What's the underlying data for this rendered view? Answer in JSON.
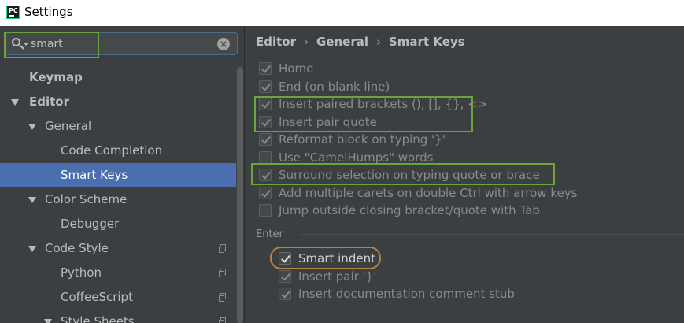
{
  "window": {
    "title": "Settings",
    "icon": "pycharm-app-icon",
    "icon_text": "PC"
  },
  "search": {
    "value": "smart",
    "clear_icon": "clear-icon"
  },
  "tree": [
    {
      "label": "Keymap",
      "level": 0,
      "bold": true,
      "expanded": null,
      "selected": false,
      "has_copy_icon": false
    },
    {
      "label": "Editor",
      "level": 0,
      "bold": true,
      "expanded": true,
      "selected": false,
      "has_copy_icon": false
    },
    {
      "label": "General",
      "level": 1,
      "bold": false,
      "expanded": true,
      "selected": false,
      "has_copy_icon": false
    },
    {
      "label": "Code Completion",
      "level": 2,
      "bold": false,
      "expanded": null,
      "selected": false,
      "has_copy_icon": false
    },
    {
      "label": "Smart Keys",
      "level": 2,
      "bold": false,
      "expanded": null,
      "selected": true,
      "has_copy_icon": false
    },
    {
      "label": "Color Scheme",
      "level": 1,
      "bold": false,
      "expanded": true,
      "selected": false,
      "has_copy_icon": false
    },
    {
      "label": "Debugger",
      "level": 2,
      "bold": false,
      "expanded": null,
      "selected": false,
      "has_copy_icon": false
    },
    {
      "label": "Code Style",
      "level": 1,
      "bold": false,
      "expanded": true,
      "selected": false,
      "has_copy_icon": true
    },
    {
      "label": "Python",
      "level": 2,
      "bold": false,
      "expanded": null,
      "selected": false,
      "has_copy_icon": true
    },
    {
      "label": "CoffeeScript",
      "level": 2,
      "bold": false,
      "expanded": null,
      "selected": false,
      "has_copy_icon": true
    },
    {
      "label": "Style Sheets",
      "level": 2,
      "bold": false,
      "expanded": true,
      "selected": false,
      "has_copy_icon": true
    }
  ],
  "breadcrumb": [
    "Editor",
    "General",
    "Smart Keys"
  ],
  "breadcrumb_separator": "›",
  "options": [
    {
      "label": "Home",
      "checked": true,
      "active": false
    },
    {
      "label": "End (on blank line)",
      "checked": true,
      "active": false
    },
    {
      "label": "Insert paired brackets (), [], {}, <>",
      "checked": true,
      "active": false
    },
    {
      "label": "Insert pair quote",
      "checked": true,
      "active": false
    },
    {
      "label": "Reformat block on typing '}'",
      "checked": true,
      "active": false
    },
    {
      "label": "Use \"CamelHumps\" words",
      "checked": false,
      "active": false
    },
    {
      "label": "Surround selection on typing quote or brace",
      "checked": true,
      "active": false
    },
    {
      "label": "Add multiple carets on double Ctrl with arrow keys",
      "checked": true,
      "active": false
    },
    {
      "label": "Jump outside closing bracket/quote with Tab",
      "checked": false,
      "active": false
    }
  ],
  "enter_section": {
    "label": "Enter",
    "options": [
      {
        "label": "Smart indent",
        "checked": true,
        "active": true
      },
      {
        "label": "Insert pair '}'",
        "checked": true,
        "active": false
      },
      {
        "label": "Insert documentation comment stub",
        "checked": true,
        "active": false
      }
    ]
  },
  "colors": {
    "highlight_green": "#6aa43a",
    "highlight_orange": "#b8843a",
    "selection": "#4b6eaf",
    "background": "#3c3f41"
  }
}
